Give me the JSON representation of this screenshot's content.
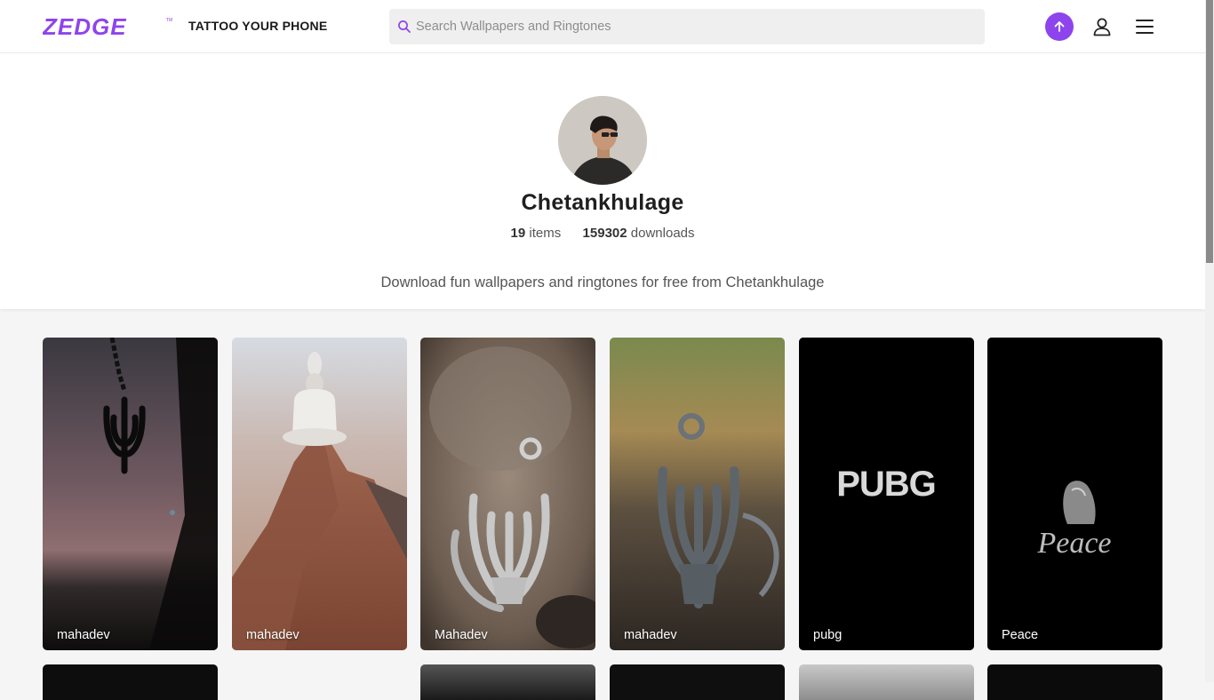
{
  "header": {
    "logo_text": "ZEDGE",
    "tagline": "TATTOO YOUR PHONE",
    "search_placeholder": "Search Wallpapers and Ringtones",
    "search_value": "",
    "upload_icon": "arrow-up-icon",
    "user_icon": "user-icon",
    "menu_icon": "hamburger-menu-icon",
    "accent_color": "#8e44ec"
  },
  "profile": {
    "name": "Chetankhulage",
    "items_count": "19",
    "items_label": "items",
    "downloads_count": "159302",
    "downloads_label": "downloads",
    "description": "Download fun wallpapers and ringtones for free from Chetankhulage"
  },
  "wallpapers": [
    {
      "title": "mahadev"
    },
    {
      "title": "mahadev"
    },
    {
      "title": "Mahadev"
    },
    {
      "title": "mahadev"
    },
    {
      "title": "pubg",
      "art_text": "PUBG"
    },
    {
      "title": "Peace",
      "art_text": "Peace"
    }
  ]
}
